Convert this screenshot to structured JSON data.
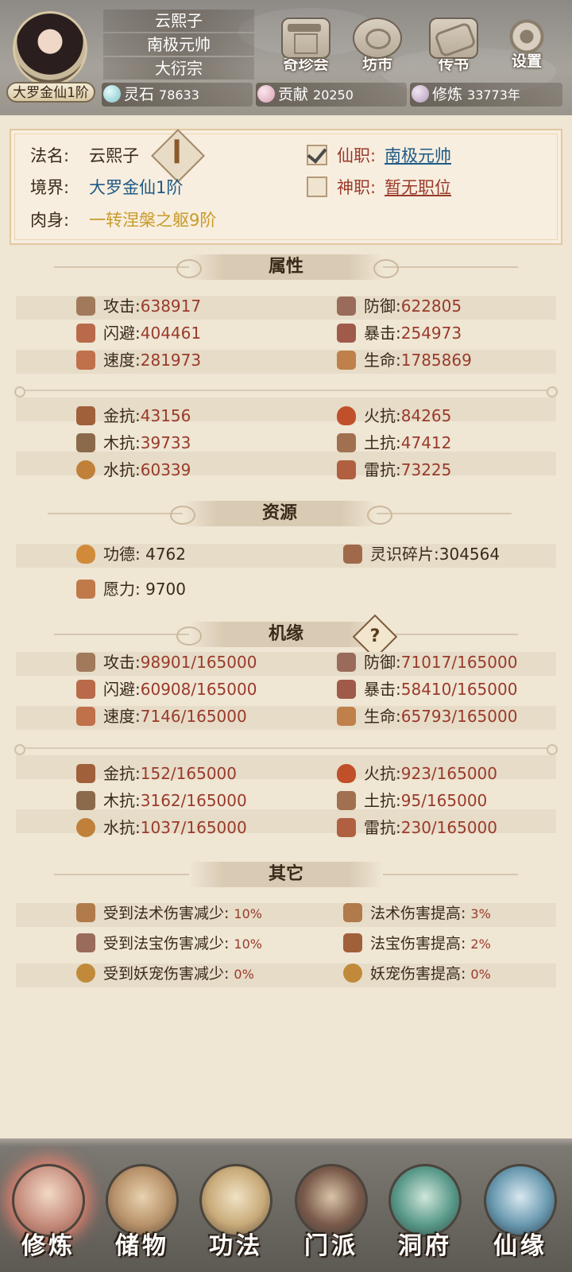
{
  "header": {
    "avatar_badge": "大罗金仙1阶",
    "name_plates": [
      "云熙子",
      "南极元帅",
      "大衍宗"
    ],
    "top_buttons": [
      {
        "label": "奇珍会",
        "icon": "treasure-pavilion-icon"
      },
      {
        "label": "坊市",
        "icon": "market-icon"
      },
      {
        "label": "传书",
        "icon": "scroll-letter-icon"
      },
      {
        "label": "设置",
        "icon": "gear-icon"
      }
    ],
    "resources": [
      {
        "label": "灵石",
        "value": "78633",
        "icon": "spirit-stone-icon",
        "color": "#7fc3c8"
      },
      {
        "label": "贡献",
        "value": "20250",
        "icon": "contribution-crystal-icon",
        "color": "#d8a0b0"
      },
      {
        "label": "修炼",
        "value": "33773年",
        "icon": "meditation-icon",
        "color": "#b59ab8"
      }
    ]
  },
  "info": {
    "fa_name_label": "法名:",
    "fa_name_value": "云熙子",
    "realm_label": "境界:",
    "realm_value": "大罗金仙1阶",
    "body_label": "肉身:",
    "body_value": "一转涅槃之躯9阶",
    "xian_label": "仙职:",
    "xian_value": "南极元帅",
    "shen_label": "神职:",
    "shen_value": "暂无职位"
  },
  "sections": {
    "attributes": "属性",
    "resources": "资源",
    "fortune": "机缘",
    "others": "其它"
  },
  "attributes": [
    {
      "k": "攻击:",
      "v": "638917",
      "icon": "attack-icon"
    },
    {
      "k": "防御:",
      "v": "622805",
      "icon": "defense-icon"
    },
    {
      "k": "闪避:",
      "v": "404461",
      "icon": "dodge-icon"
    },
    {
      "k": "暴击:",
      "v": "254973",
      "icon": "critical-icon"
    },
    {
      "k": "速度:",
      "v": "281973",
      "icon": "speed-icon"
    },
    {
      "k": "生命:",
      "v": "1785869",
      "icon": "life-icon"
    }
  ],
  "resistances": [
    {
      "k": "金抗:",
      "v": "43156",
      "icon": "metal-resist-icon"
    },
    {
      "k": "火抗:",
      "v": "84265",
      "icon": "fire-resist-icon"
    },
    {
      "k": "木抗:",
      "v": "39733",
      "icon": "wood-resist-icon"
    },
    {
      "k": "土抗:",
      "v": "47412",
      "icon": "earth-resist-icon"
    },
    {
      "k": "水抗:",
      "v": "60339",
      "icon": "water-resist-icon"
    },
    {
      "k": "雷抗:",
      "v": "73225",
      "icon": "thunder-resist-icon"
    }
  ],
  "resources_list": [
    {
      "k": "功德:",
      "v": "4762",
      "icon": "merit-icon"
    },
    {
      "k": "灵识碎片:",
      "v": "304564",
      "icon": "spirit-shard-icon"
    },
    {
      "k": "愿力:",
      "v": "9700",
      "icon": "wish-power-icon"
    }
  ],
  "fortune_help": "?",
  "fortune_attributes": [
    {
      "k": "攻击:",
      "v": "98901/165000",
      "icon": "attack-icon"
    },
    {
      "k": "防御:",
      "v": "71017/165000",
      "icon": "defense-icon"
    },
    {
      "k": "闪避:",
      "v": "60908/165000",
      "icon": "dodge-icon"
    },
    {
      "k": "暴击:",
      "v": "58410/165000",
      "icon": "critical-icon"
    },
    {
      "k": "速度:",
      "v": "7146/165000",
      "icon": "speed-icon"
    },
    {
      "k": "生命:",
      "v": "65793/165000",
      "icon": "life-icon"
    }
  ],
  "fortune_resistances": [
    {
      "k": "金抗:",
      "v": "152/165000",
      "icon": "metal-resist-icon"
    },
    {
      "k": "火抗:",
      "v": "923/165000",
      "icon": "fire-resist-icon"
    },
    {
      "k": "木抗:",
      "v": "3162/165000",
      "icon": "wood-resist-icon"
    },
    {
      "k": "土抗:",
      "v": "95/165000",
      "icon": "earth-resist-icon"
    },
    {
      "k": "水抗:",
      "v": "1037/165000",
      "icon": "water-resist-icon"
    },
    {
      "k": "雷抗:",
      "v": "230/165000",
      "icon": "thunder-resist-icon"
    }
  ],
  "others": [
    {
      "k": "受到法术伤害减少:",
      "v": "10%",
      "icon": "spell-reduce-icon"
    },
    {
      "k": "法术伤害提高:",
      "v": "3%",
      "icon": "spell-boost-icon"
    },
    {
      "k": "受到法宝伤害减少:",
      "v": "10%",
      "icon": "artifact-reduce-icon"
    },
    {
      "k": "法宝伤害提高:",
      "v": "2%",
      "icon": "artifact-boost-icon"
    },
    {
      "k": "受到妖宠伤害减少:",
      "v": "0%",
      "icon": "pet-reduce-icon"
    },
    {
      "k": "妖宠伤害提高:",
      "v": "0%",
      "icon": "pet-boost-icon"
    }
  ],
  "bottom_nav": [
    {
      "label": "修炼",
      "icon": "cultivation-icon",
      "active": true
    },
    {
      "label": "储物",
      "icon": "storage-bag-icon",
      "active": false
    },
    {
      "label": "功法",
      "icon": "technique-scroll-icon",
      "active": false
    },
    {
      "label": "门派",
      "icon": "sect-gate-icon",
      "active": false
    },
    {
      "label": "洞府",
      "icon": "cave-abode-icon",
      "active": false
    },
    {
      "label": "仙缘",
      "icon": "immortal-fate-icon",
      "active": false
    }
  ],
  "colors": {
    "value_red": "#9a3a2a",
    "link_blue": "#1f5a86",
    "body_gold": "#c89a2a",
    "panel_bg": "#efe6d4"
  }
}
